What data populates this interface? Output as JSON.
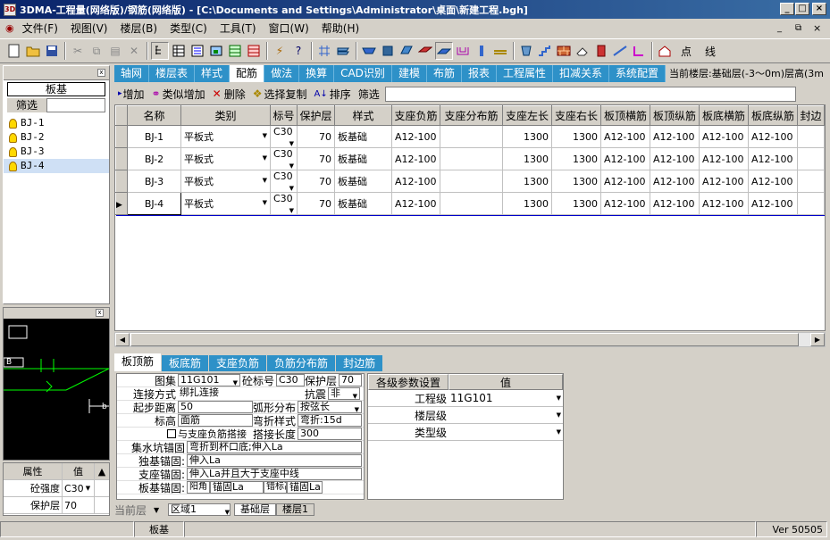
{
  "window": {
    "title": "3DMA-工程量(网络版)/钢筋(网络版) - [C:\\Documents and Settings\\Administrator\\桌面\\新建工程.bgh]",
    "min": "_",
    "max": "□",
    "close": "×"
  },
  "menu": [
    "文件(F)",
    "视图(V)",
    "楼层(B)",
    "类型(C)",
    "工具(T)",
    "窗口(W)",
    "帮助(H)"
  ],
  "mdi_controls": [
    "_",
    "⧉",
    "×"
  ],
  "toolbar_right": [
    "点",
    "线"
  ],
  "tree": {
    "title": "板基",
    "filter_label": "筛选",
    "filter_value": "",
    "items": [
      "BJ-1",
      "BJ-2",
      "BJ-3",
      "BJ-4"
    ],
    "selected": 3
  },
  "view_label": "B",
  "view_label2": "b",
  "props": {
    "h1": "属性",
    "h2": "值",
    "rows": [
      {
        "k": "砼强度",
        "v": "C30"
      },
      {
        "k": "保护层",
        "v": "70"
      }
    ]
  },
  "tabs": [
    "轴网",
    "楼层表",
    "样式",
    "配筋",
    "做法",
    "换算",
    "CAD识别",
    "建模",
    "布筋",
    "报表",
    "工程属性",
    "扣减关系",
    "系统配置"
  ],
  "active_tab": 3,
  "floor_info": "当前楼层:基础层(-3〜0m)层高(3m",
  "grid_toolbar": {
    "add": "增加",
    "similar": "类似增加",
    "delete": "删除",
    "select_copy": "选择复制",
    "sort": "排序",
    "filter": "筛选",
    "filter_value": ""
  },
  "grid": {
    "columns": [
      "名称",
      "类别",
      "标号",
      "保护层",
      "样式",
      "支座负筋",
      "支座分布筋",
      "支座左长",
      "支座右长",
      "板顶横筋",
      "板顶纵筋",
      "板底横筋",
      "板底纵筋",
      "封边"
    ],
    "rows": [
      [
        "BJ-1",
        "平板式",
        "C30",
        "70",
        "板基础",
        "A12-100",
        "",
        "1300",
        "1300",
        "A12-100",
        "A12-100",
        "A12-100",
        "A12-100",
        ""
      ],
      [
        "BJ-2",
        "平板式",
        "C30",
        "70",
        "板基础",
        "A12-100",
        "",
        "1300",
        "1300",
        "A12-100",
        "A12-100",
        "A12-100",
        "A12-100",
        ""
      ],
      [
        "BJ-3",
        "平板式",
        "C30",
        "70",
        "板基础",
        "A12-100",
        "",
        "1300",
        "1300",
        "A12-100",
        "A12-100",
        "A12-100",
        "A12-100",
        ""
      ],
      [
        "BJ-4",
        "平板式",
        "C30",
        "70",
        "板基础",
        "A12-100",
        "",
        "1300",
        "1300",
        "A12-100",
        "A12-100",
        "A12-100",
        "A12-100",
        ""
      ]
    ],
    "current_row": 3
  },
  "bottom_tabs": [
    "板顶筋",
    "板底筋",
    "支座负筋",
    "负筋分布筋",
    "封边筋"
  ],
  "bottom_active": 0,
  "detail": {
    "atlas_label": "图集",
    "atlas": "11G101",
    "grade_label": "砼标号",
    "grade": "C30",
    "cover_label": "保护层",
    "cover": "70",
    "conn_label": "连接方式",
    "conn": "绑扎连接",
    "seismic_label": "抗震",
    "seismic": "非",
    "start_label": "起步距离",
    "start": "50",
    "arc_label": "弧形分布",
    "arc": "按弦长",
    "elev_label": "标高",
    "elev": "面筋",
    "bend_label": "弯折样式",
    "bend": "弯折:15d",
    "overlap_check": "与支座负筋搭接",
    "lap_label": "搭接长度",
    "lap": "300",
    "pit_label": "集水坑锚固",
    "pit": "弯折到杯口底;伸入La",
    "single_label": "独基锚固:",
    "single": "伸入La",
    "support_label": "支座锚固:",
    "support": "伸入La并且大于支座中线",
    "edge_label": "板基锚固:",
    "edge_a": "阳角",
    "edge_b": "锚固La",
    "edge_c": "错标高",
    "edge_d": "锚固La"
  },
  "params": {
    "h1": "各级参数设置",
    "h2": "值",
    "rows": [
      {
        "k": "工程级",
        "v": "11G101"
      },
      {
        "k": "楼层级",
        "v": ""
      },
      {
        "k": "类型级",
        "v": ""
      }
    ]
  },
  "sheets": {
    "floor_label": "当前层",
    "region": "区域1",
    "tabs": [
      "基础层",
      "楼层1"
    ]
  },
  "status": {
    "left": "板基",
    "version": "Ver 50505"
  }
}
